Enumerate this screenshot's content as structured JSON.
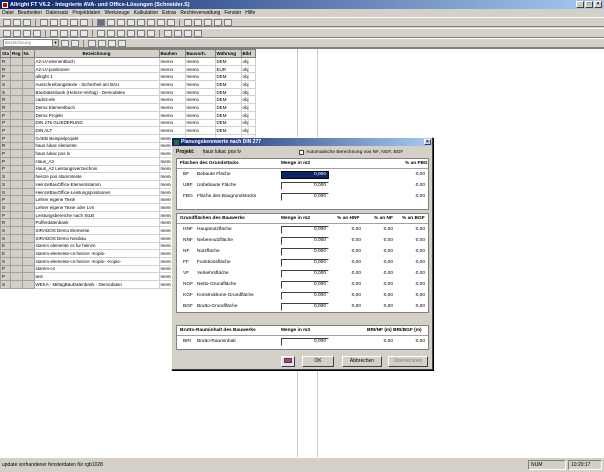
{
  "window": {
    "title": "Allright FT V6.2 - Integrierte AVA- und Office-Lösungen (Schneider.S)"
  },
  "menu": [
    "Datei",
    "Bearbeiten",
    "Datensatz",
    "Projektdaten",
    "Werkzeuge",
    "Kalkulation",
    "Extras",
    "Rechteverwaltung",
    "Fenster",
    "Hilfe"
  ],
  "toolbar": {
    "combo_placeholder": "Bezeichnung"
  },
  "grid": {
    "headers": [
      "Sta",
      "Reg",
      "Nr.",
      "Bezeichnung",
      "Bauhen",
      "Bauvorh.",
      "Währung",
      "Bild"
    ],
    "rows": [
      [
        "R",
        "",
        "",
        "A2-LV-elementbuch",
        "memo",
        "memo",
        "DEM",
        "obj"
      ],
      [
        "R",
        "",
        "",
        "A2-LV-positionen",
        "memo",
        "memo",
        "EUR",
        "obj"
      ],
      [
        "P",
        "",
        "",
        "allright 1",
        "memo",
        "memo",
        "DEM",
        "obj"
      ],
      [
        "S",
        "",
        "",
        "Ausschreibungstexte - Sicherheit am BAU",
        "memo",
        "memo",
        "DEM",
        "obj"
      ],
      [
        "S",
        "",
        "",
        "BauDatenbank (Heinze-Verlag) - Demodaten",
        "memo",
        "memo",
        "DEM",
        "obj"
      ],
      [
        "R",
        "",
        "",
        "cads3-ele",
        "memo",
        "memo",
        "DEM",
        "obj"
      ],
      [
        "R",
        "",
        "",
        "Demo Elementbuch",
        "memo",
        "memo",
        "DEM",
        "obj"
      ],
      [
        "P",
        "",
        "",
        "Demo Projekt",
        "memo",
        "memo",
        "DEM",
        "obj"
      ],
      [
        "P",
        "",
        "",
        "DIN 276 GLIEDERUNG",
        "memo",
        "memo",
        "DEM",
        "obj"
      ],
      [
        "P",
        "",
        "",
        "DIN ALT",
        "memo",
        "memo",
        "DEM",
        "obj"
      ],
      [
        "P",
        "",
        "",
        "GAEB Beispielprojekt",
        "memo",
        "",
        "",
        ""
      ],
      [
        "R",
        "",
        "",
        "haus lukac elemente",
        "memo",
        "",
        "",
        ""
      ],
      [
        "P",
        "",
        "",
        "haus lukac pos lv",
        "memo",
        "",
        "",
        ""
      ],
      [
        "P",
        "",
        "",
        "Haus_A2",
        "memo",
        "",
        "",
        ""
      ],
      [
        "P",
        "",
        "",
        "Haus_A2 Leistungsverzeichnis",
        "memo",
        "",
        "",
        ""
      ],
      [
        "S",
        "",
        "",
        "heinze pos stammtexte",
        "memo",
        "",
        "",
        ""
      ],
      [
        "S",
        "",
        "",
        "HeinzeBauOffice-Elementstamm",
        "memo",
        "",
        "",
        ""
      ],
      [
        "S",
        "",
        "",
        "HeinzeBauOffice-Leistungspositionen",
        "memo",
        "",
        "",
        ""
      ],
      [
        "P",
        "",
        "",
        "Lehrer eigene Texte",
        "memo",
        "",
        "",
        ""
      ],
      [
        "S",
        "",
        "",
        "Lehrer eigene Texte oder LVs",
        "memo",
        "",
        "",
        ""
      ],
      [
        "P",
        "",
        "",
        "Leistungsbereiche nach StLB",
        "memo",
        "",
        "",
        ""
      ],
      [
        "R",
        "",
        "",
        "Pufferdatenbank",
        "memo",
        "",
        "",
        ""
      ],
      [
        "S",
        "",
        "",
        "SIRADOS Demo Elemente",
        "memo",
        "",
        "",
        ""
      ],
      [
        "S",
        "",
        "",
        "SIRADOS Demo Neubau",
        "memo",
        "",
        "",
        ""
      ],
      [
        "E",
        "",
        "",
        "stamm elemente cs fur heinze",
        "memo",
        "",
        "",
        ""
      ],
      [
        "E",
        "",
        "",
        "stamm-elemente-cs-heinze -Kopie-",
        "memo",
        "",
        "",
        ""
      ],
      [
        "S",
        "",
        "",
        "stamm-elemente-cs-heinze -Kopie- -Kopie-",
        "memo",
        "",
        "",
        ""
      ],
      [
        "P",
        "",
        "",
        "stamm-cs",
        "memo",
        "",
        "",
        ""
      ],
      [
        "P",
        "",
        "",
        "test",
        "memo",
        "",
        "",
        ""
      ],
      [
        "S",
        "",
        "",
        "WEKA - MittagBauDatenbank - Demodaten",
        "memo",
        "",
        "",
        ""
      ]
    ]
  },
  "dialog": {
    "title": "Planungskennwerte nach DIN 277",
    "project_label": "Projekt:",
    "project_value": "haus lukac pos lv",
    "auto_calc_label": "Automatische Berechnung von NF, NGF, BGF",
    "sec1": {
      "title": "Flächen des Grundstücks",
      "col_menge": "Menge in m2",
      "col_pct": "% an FBG",
      "rows": [
        {
          "abbr": "BF",
          "label": "Bebaute Fläche",
          "value": "0,000",
          "pct": "0,00"
        },
        {
          "abbr": "UBF",
          "label": "Unbebaute Fläche",
          "value": "0,000",
          "pct": "0,00"
        },
        {
          "abbr": "FBG",
          "label": "Fläche des Baugrundstücks",
          "value": "0,000",
          "pct": "0,00"
        }
      ]
    },
    "sec2": {
      "title": "Grundflächen des Bauwerks",
      "col_menge": "Menge in m2",
      "col_hnf": "% an HNF",
      "col_nf": "% an NF",
      "col_bgf": "% an BGF",
      "rows": [
        {
          "abbr": "HNF",
          "label": "Hauptnutzfläche",
          "value": "0,000",
          "a": "0,00",
          "b": "0,00",
          "c": "0,00"
        },
        {
          "abbr": "NNF",
          "label": "Nebennutzfläche",
          "value": "0,000",
          "a": "0,00",
          "b": "0,00",
          "c": "0,00"
        },
        {
          "abbr": "NF",
          "label": "Nutzfläche",
          "value": "0,000",
          "a": "0,00",
          "b": "0,00",
          "c": "0,00"
        },
        {
          "abbr": "FF",
          "label": "Funktionsfläche",
          "value": "0,000",
          "a": "0,00",
          "b": "0,00",
          "c": "0,00"
        },
        {
          "abbr": "VF",
          "label": "Verkehrsfläche",
          "value": "0,000",
          "a": "0,00",
          "b": "0,00",
          "c": "0,00"
        },
        {
          "abbr": "NGF",
          "label": "Netto-Grundfläche",
          "value": "0,000",
          "a": "0,00",
          "b": "0,00",
          "c": "0,00"
        },
        {
          "abbr": "KGF",
          "label": "Konstruktions-Grundfläche",
          "value": "0,000",
          "a": "0,00",
          "b": "0,00",
          "c": "0,00"
        },
        {
          "abbr": "BGF",
          "label": "Brutto-Grundfläche",
          "value": "0,000",
          "a": "0,00",
          "b": "0,00",
          "c": "0,00"
        }
      ]
    },
    "sec3": {
      "title": "Brutto-Rauminhalt des Bauwerks",
      "col_menge": "Menge in m3",
      "col_ratio": "BRI/NF (m) BRI/BGF (m)",
      "row": {
        "abbr": "BRI",
        "label": "Brutto-Rauminhalt",
        "value": "0,000",
        "a": "0,00",
        "b": "0,00"
      }
    },
    "buttons": {
      "ok": "OK",
      "cancel": "Abbrechen",
      "apply": "Übernehmen"
    }
  },
  "status": {
    "text": "update vorhandener fensterdaten für rgb1028",
    "num": "NUM",
    "time": "10:20:17"
  }
}
